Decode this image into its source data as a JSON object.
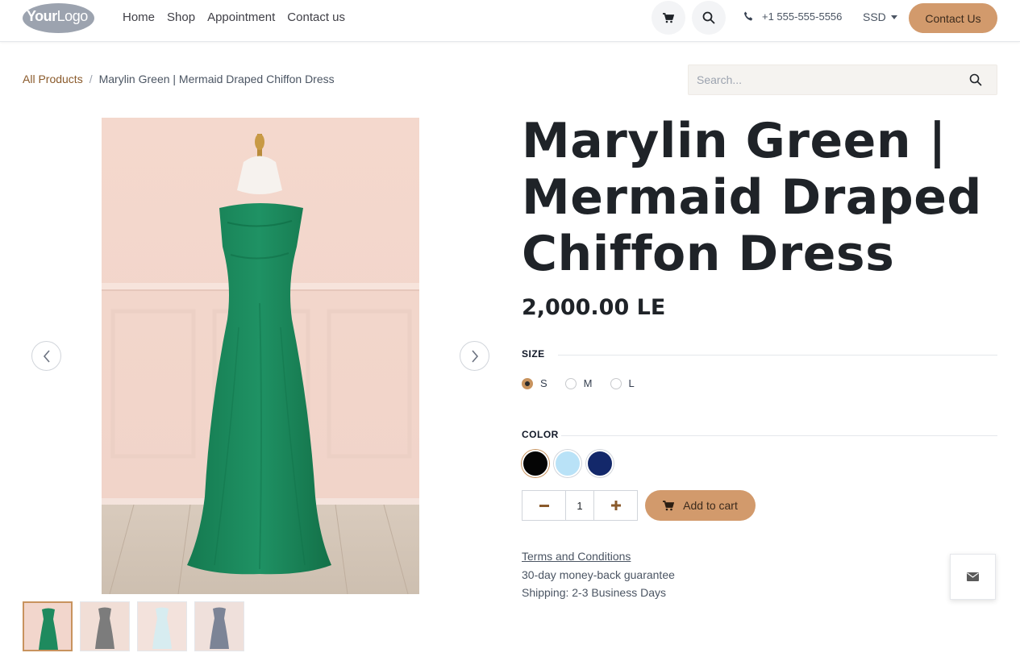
{
  "header": {
    "logo": {
      "bold": "Your",
      "light": "Logo"
    },
    "nav": [
      "Home",
      "Shop",
      "Appointment",
      "Contact us"
    ],
    "phone": "+1 555-555-5556",
    "currency": "SSD",
    "contact_button": "Contact Us"
  },
  "breadcrumb": {
    "root": "All Products",
    "separator": "/",
    "current": "Marylin Green | Mermaid Draped Chiffon Dress"
  },
  "search": {
    "placeholder": "Search..."
  },
  "product": {
    "title": "Marylin Green | Mermaid Draped Chiffon Dress",
    "price": "2,000.00 LE",
    "size_label": "SIZE",
    "sizes": [
      {
        "label": "S",
        "selected": true
      },
      {
        "label": "M",
        "selected": false
      },
      {
        "label": "L",
        "selected": false
      }
    ],
    "color_label": "COLOR",
    "colors": [
      {
        "value": "#050505",
        "selected": true
      },
      {
        "value": "#b9e2f7",
        "selected": false
      },
      {
        "value": "#13286a",
        "selected": false
      }
    ],
    "quantity": "1",
    "add_to_cart": "Add to cart",
    "terms": "Terms and Conditions",
    "guarantee": "30-day money-back guarantee",
    "shipping": "Shipping: 2-3 Business Days"
  },
  "thumbnails": [
    {
      "color": "#1e8a5e",
      "bg": "#f2d6cc"
    },
    {
      "color": "#7c7c7c",
      "bg": "#f1ded6"
    },
    {
      "color": "#d7ecf0",
      "bg": "#f3e2dc"
    },
    {
      "color": "#7c8496",
      "bg": "#efe0db"
    }
  ],
  "colors": {
    "accent": "#d29a6c",
    "link": "#8a5a2b",
    "dress": "#1e8a5e"
  }
}
